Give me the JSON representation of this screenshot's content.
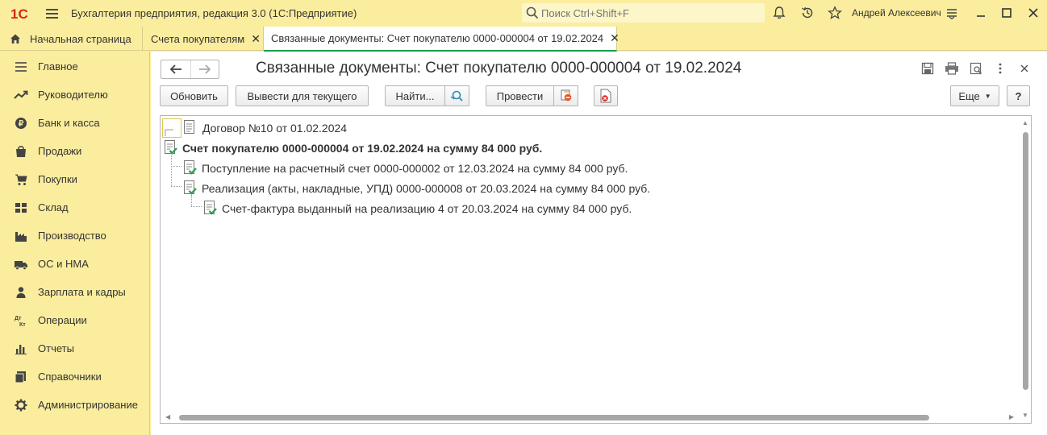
{
  "app": {
    "title": "Бухгалтерия предприятия, редакция 3.0  (1С:Предприятие)",
    "logo_text": "1С",
    "search_placeholder": "Поиск Ctrl+Shift+F",
    "user": "Андрей Алексеевич"
  },
  "tabs": [
    {
      "label": "Начальная страница",
      "icon": "home-icon"
    },
    {
      "label": "Счета покупателям",
      "closable": true
    },
    {
      "label": "Связанные документы: Счет покупателю 0000-000004 от 19.02.2024",
      "closable": true,
      "active": true
    }
  ],
  "sidebar": {
    "items": [
      {
        "label": "Главное",
        "icon": "menu-lines-icon"
      },
      {
        "label": "Руководителю",
        "icon": "trend-icon"
      },
      {
        "label": "Банк и касса",
        "icon": "coin-icon"
      },
      {
        "label": "Продажи",
        "icon": "shopping-bag-icon"
      },
      {
        "label": "Покупки",
        "icon": "cart-icon"
      },
      {
        "label": "Склад",
        "icon": "warehouse-grid-icon"
      },
      {
        "label": "Производство",
        "icon": "factory-icon"
      },
      {
        "label": "ОС и НМА",
        "icon": "truck-icon"
      },
      {
        "label": "Зарплата и кадры",
        "icon": "person-icon"
      },
      {
        "label": "Операции",
        "icon": "dt-kt-icon"
      },
      {
        "label": "Отчеты",
        "icon": "bar-chart-icon"
      },
      {
        "label": "Справочники",
        "icon": "books-icon"
      },
      {
        "label": "Администрирование",
        "icon": "gear-icon"
      }
    ]
  },
  "form": {
    "title": "Связанные документы: Счет покупателю 0000-000004 от 19.02.2024",
    "buttons": {
      "refresh": "Обновить",
      "show_for_current": "Вывести для текущего",
      "find": "Найти...",
      "post": "Провести",
      "more": "Еще",
      "help": "?"
    },
    "tree": [
      {
        "label": "Договор №10 от 01.02.2024",
        "level": 0,
        "bold": false,
        "posted": false
      },
      {
        "label": "Счет покупателю 0000-000004 от 19.02.2024 на сумму 84 000 руб.",
        "level": 0,
        "bold": true,
        "posted": true
      },
      {
        "label": "Поступление на расчетный счет 0000-000002 от 12.03.2024 на сумму 84 000 руб.",
        "level": 1,
        "bold": false,
        "posted": true
      },
      {
        "label": "Реализация (акты, накладные, УПД) 0000-000008 от 20.03.2024 на сумму 84 000 руб.",
        "level": 1,
        "bold": false,
        "posted": true
      },
      {
        "label": "Счет-фактура выданный на реализацию 4 от 20.03.2024 на сумму 84 000 руб.",
        "level": 2,
        "bold": false,
        "posted": true
      }
    ]
  },
  "colors": {
    "chrome_bg": "#fbed9e",
    "brand_red": "#d9261c",
    "active_tab_accent": "#1f9b4b",
    "posted_check": "#2ea44f"
  }
}
